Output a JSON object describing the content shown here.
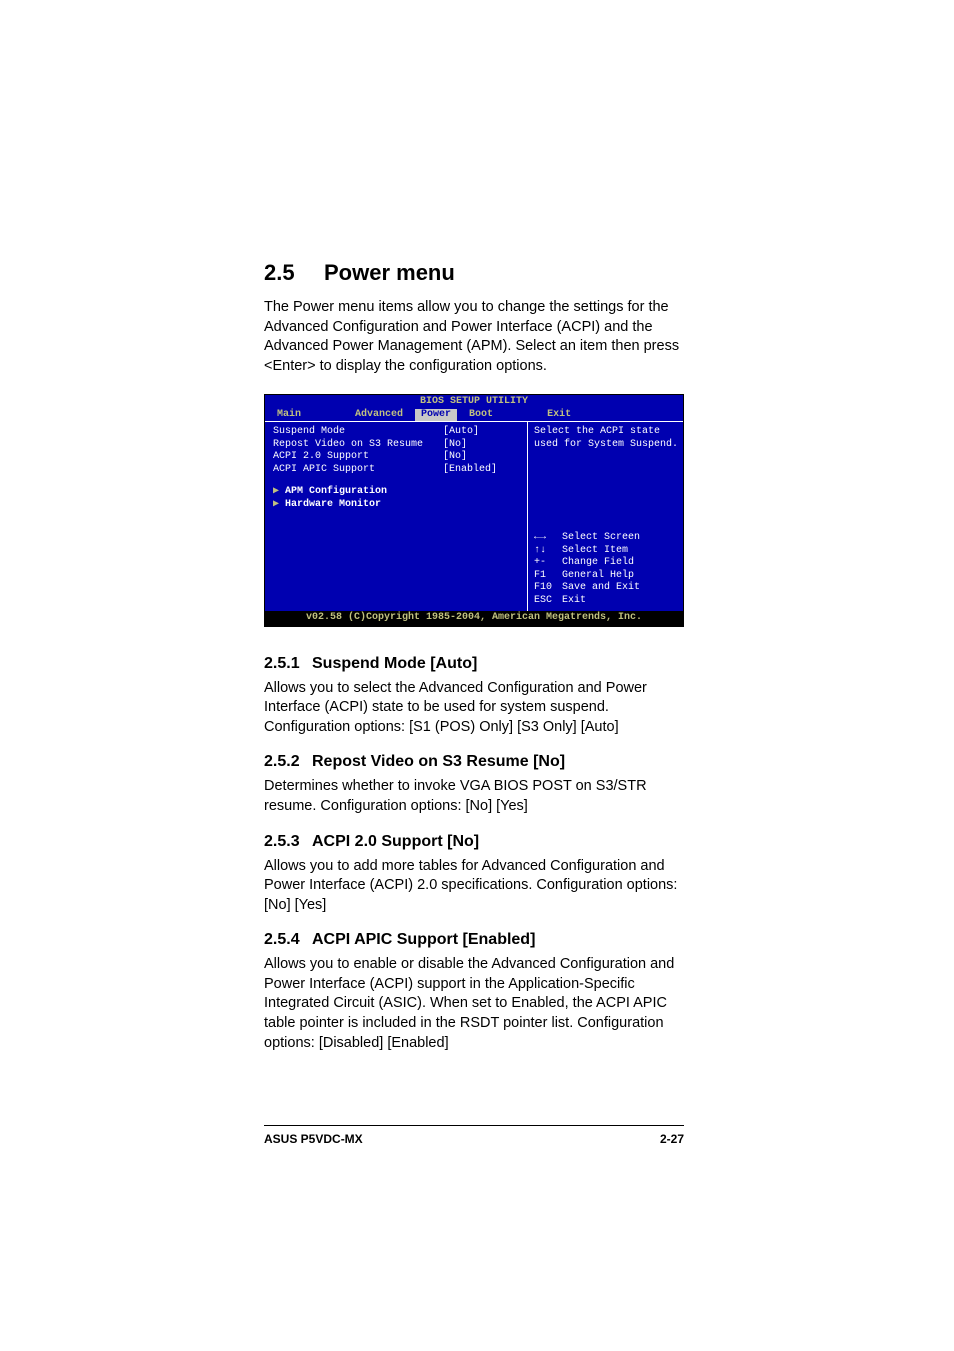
{
  "heading": {
    "number": "2.5",
    "title": "Power menu"
  },
  "intro": "The Power menu items allow you to change the settings for the Advanced Configuration and Power Interface (ACPI) and the Advanced Power Management (APM). Select an item then press <Enter> to display the configuration options.",
  "bios": {
    "title": "BIOS SETUP UTILITY",
    "tabs": {
      "main": "Main",
      "advanced": "Advanced",
      "power": "Power",
      "boot": "Boot",
      "exit": "Exit"
    },
    "options": [
      {
        "label": "Suspend Mode",
        "value": "[Auto]"
      },
      {
        "label": "Repost Video on S3 Resume",
        "value": "[No]"
      },
      {
        "label": "ACPI 2.0 Support",
        "value": "[No]"
      },
      {
        "label": "ACPI APIC Support",
        "value": "[Enabled]"
      }
    ],
    "subs": [
      {
        "label": "APM Configuration"
      },
      {
        "label": "Hardware Monitor"
      }
    ],
    "help_top": "Select the ACPI state used for System Suspend.",
    "keys": [
      {
        "k": "←→",
        "d": "Select Screen"
      },
      {
        "k": "↑↓",
        "d": "Select Item"
      },
      {
        "k": "+-",
        "d": "Change Field"
      },
      {
        "k": "F1",
        "d": "General Help"
      },
      {
        "k": "F10",
        "d": "Save and Exit"
      },
      {
        "k": "ESC",
        "d": "Exit"
      }
    ],
    "footer": "v02.58 (C)Copyright 1985-2004, American Megatrends, Inc."
  },
  "sections": [
    {
      "num": "2.5.1",
      "title": "Suspend Mode [Auto]",
      "body": "Allows you to select the Advanced Configuration and Power Interface (ACPI) state to be used for system suspend.\nConfiguration options: [S1 (POS) Only] [S3 Only] [Auto]"
    },
    {
      "num": "2.5.2",
      "title": "Repost Video on S3 Resume [No]",
      "body": "Determines whether to invoke VGA BIOS POST on S3/STR resume. Configuration options: [No] [Yes]"
    },
    {
      "num": "2.5.3",
      "title": "ACPI 2.0 Support [No]",
      "body": "Allows you to add more tables for Advanced Configuration and Power Interface (ACPI) 2.0 specifications. Configuration options: [No] [Yes]"
    },
    {
      "num": "2.5.4",
      "title": "ACPI APIC Support [Enabled]",
      "body": "Allows you to enable or disable the Advanced Configuration and Power Interface (ACPI) support in the Application-Specific Integrated Circuit (ASIC). When set to Enabled, the ACPI APIC table pointer is included in the RSDT pointer list. Configuration options: [Disabled] [Enabled]"
    }
  ],
  "footer": {
    "left": "ASUS P5VDC-MX",
    "right": "2-27"
  }
}
